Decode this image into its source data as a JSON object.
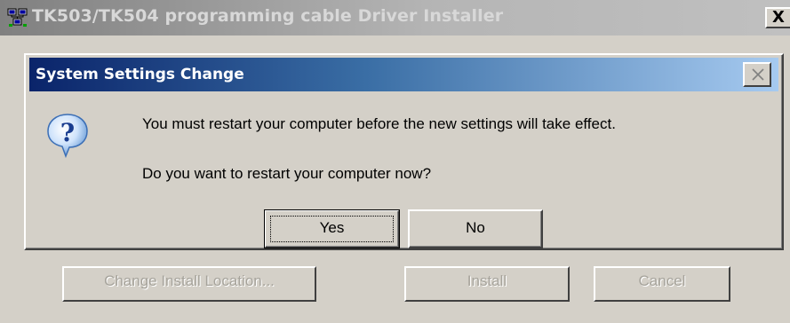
{
  "background_window": {
    "title": "TK503/TK504 programming cable Driver Installer",
    "app_icon": "network-computers-icon",
    "close_label": "X",
    "buttons": {
      "change_location": "Change Install Location...",
      "install": "Install",
      "cancel": "Cancel"
    }
  },
  "dialog": {
    "title": "System Settings Change",
    "close_icon": "close-icon",
    "icon": "question-icon",
    "message_line1": "You must restart your computer before the new settings will take effect.",
    "message_line2": "Do you want to restart your computer now?",
    "yes_label": "Yes",
    "no_label": "No"
  },
  "colors": {
    "dialog_title_gradient_start": "#0a246a",
    "dialog_title_gradient_end": "#a6caf0",
    "window_face": "#d4d0c8",
    "inactive_title_gradient_start": "#808080"
  }
}
